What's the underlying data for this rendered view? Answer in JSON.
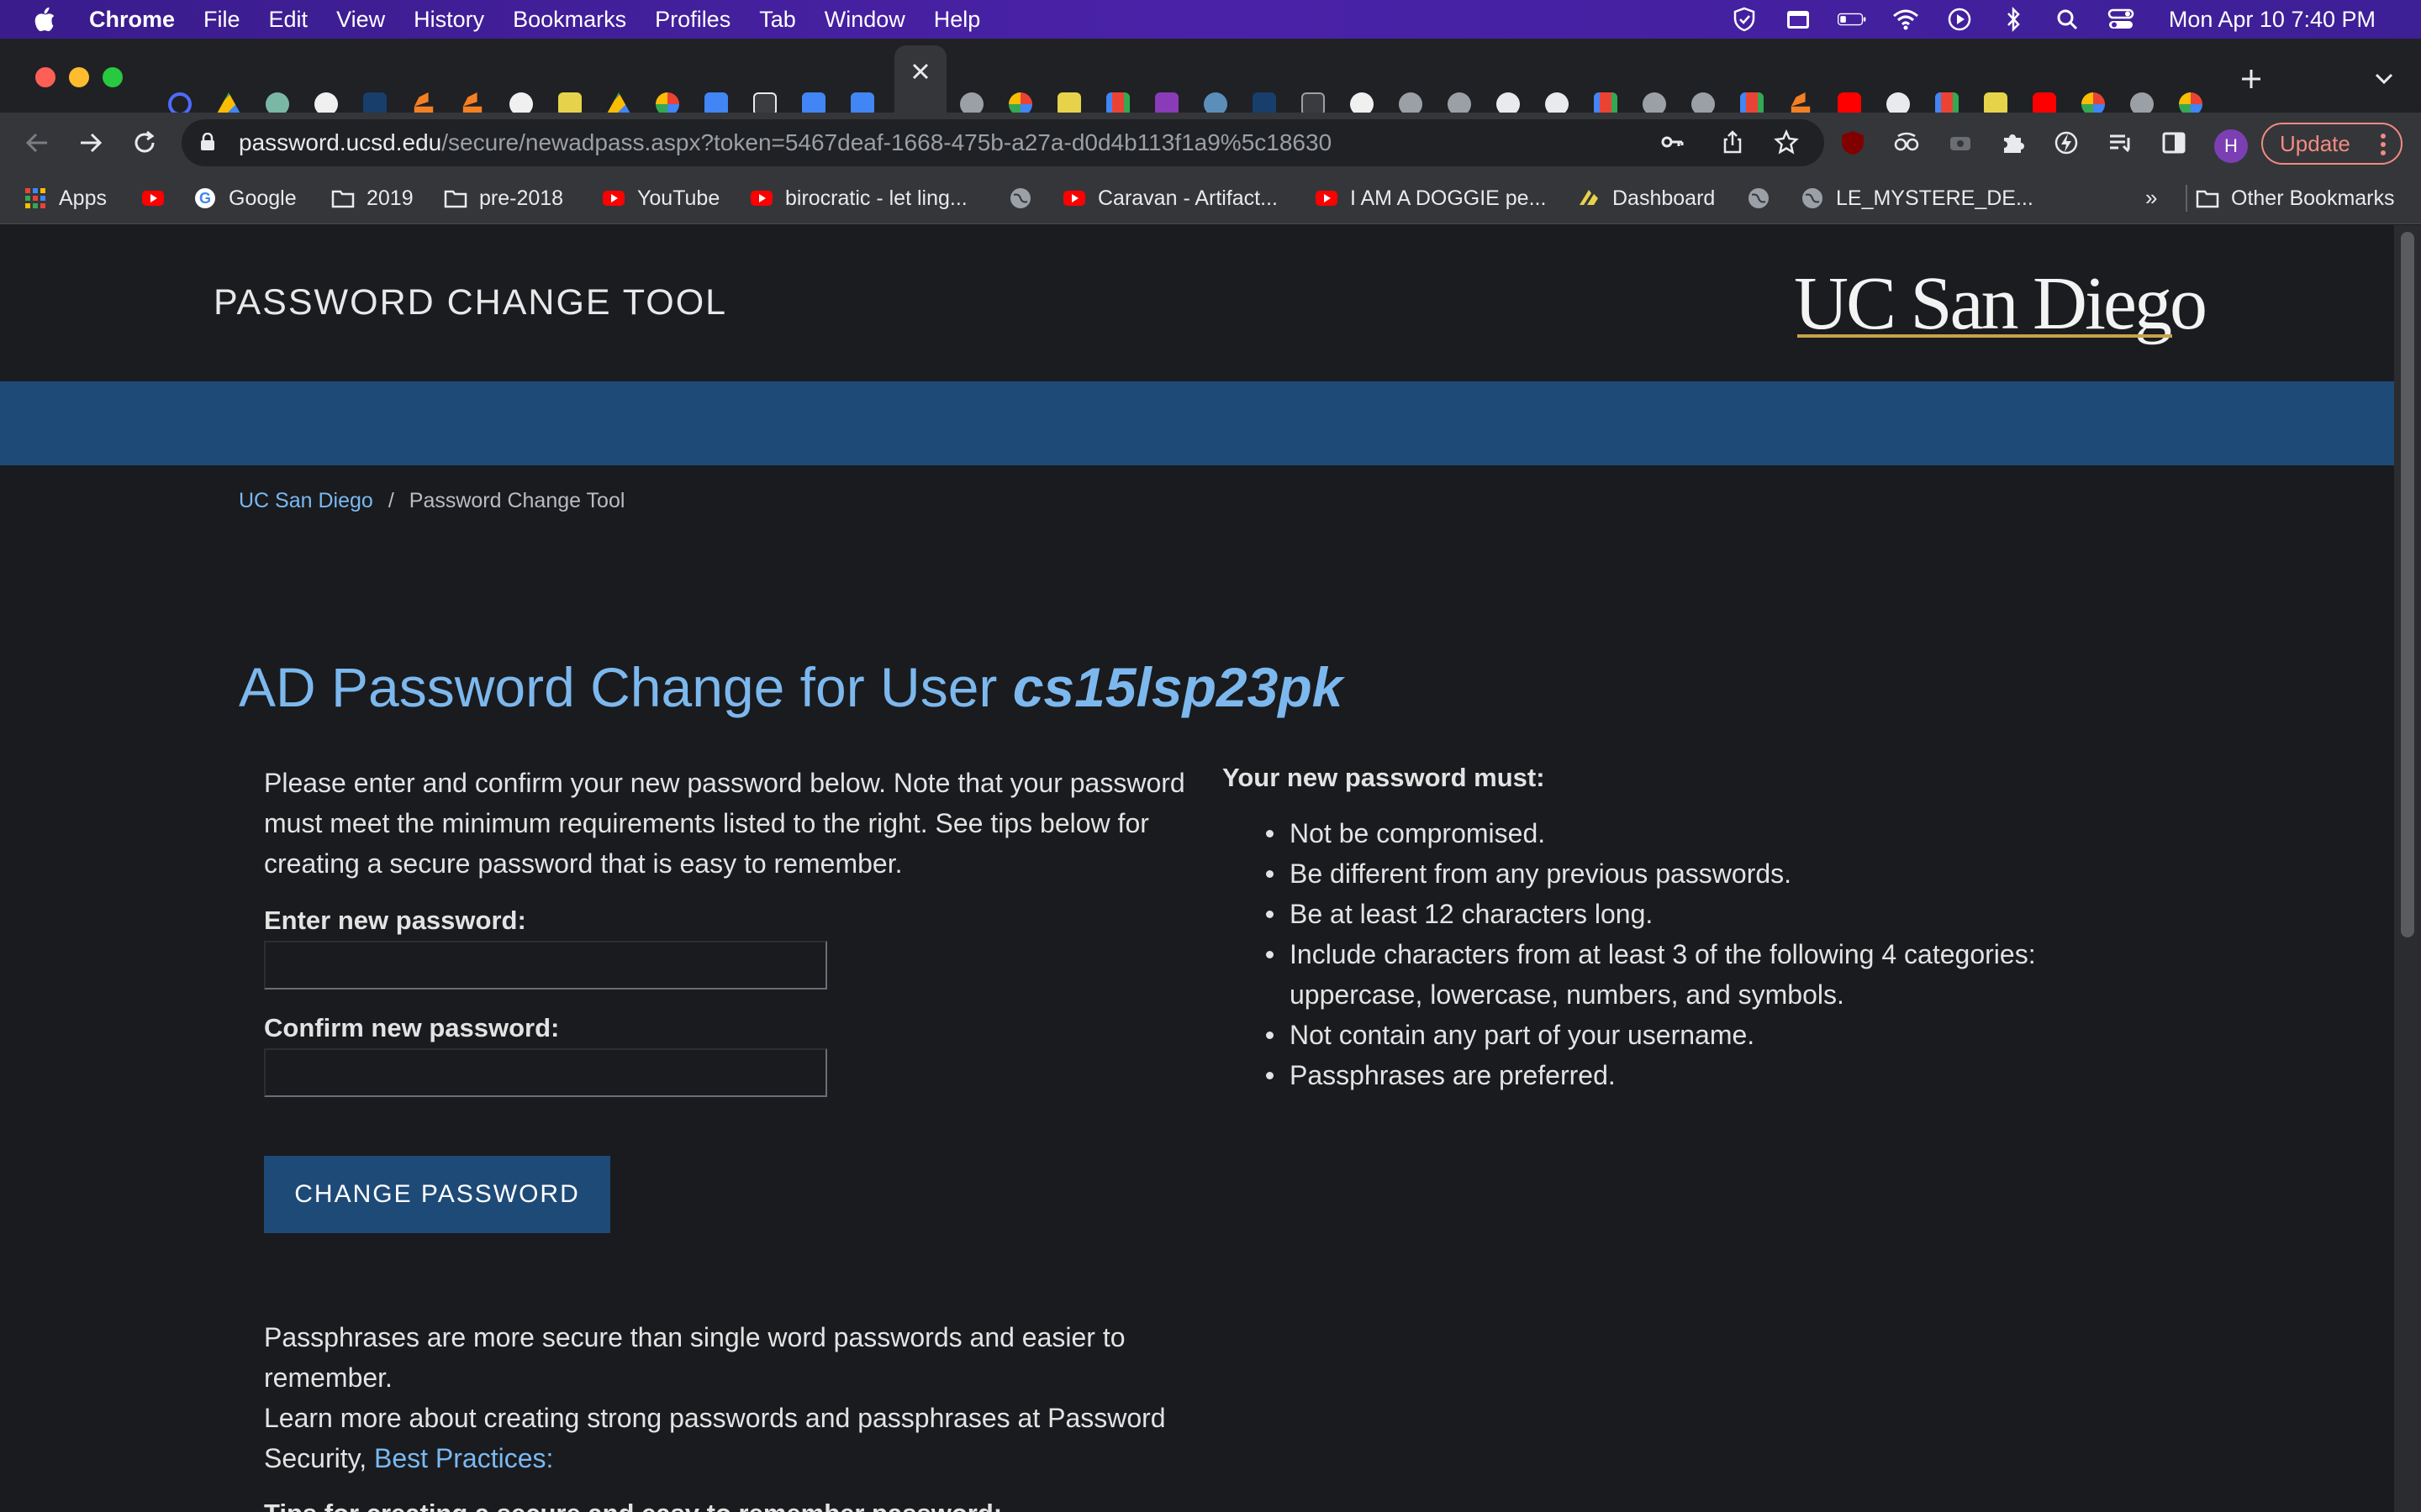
{
  "menubar": {
    "app": "Chrome",
    "items": [
      "File",
      "Edit",
      "View",
      "History",
      "Bookmarks",
      "Profiles",
      "Tab",
      "Window",
      "Help"
    ],
    "clock": "Mon Apr 10  7:40 PM"
  },
  "toolbar": {
    "url_host": "password.ucsd.edu",
    "url_path": "/secure/newadpass.aspx?token=5467deaf-1668-475b-a27a-d0d4b113f1a9%5c18630",
    "avatar_initial": "H",
    "update_label": "Update"
  },
  "bookmarks": {
    "items": [
      {
        "label": "Apps",
        "icon": "apps-grid-icon"
      },
      {
        "label": "",
        "icon": "youtube-icon"
      },
      {
        "label": "Google",
        "icon": "google-icon"
      },
      {
        "label": "2019",
        "icon": "folder-icon"
      },
      {
        "label": "pre-2018",
        "icon": "folder-icon"
      },
      {
        "label": "YouTube",
        "icon": "youtube-icon"
      },
      {
        "label": "birocratic - let ling...",
        "icon": "youtube-icon"
      },
      {
        "label": "",
        "icon": "globe-icon"
      },
      {
        "label": "Caravan - Artifact...",
        "icon": "youtube-icon"
      },
      {
        "label": "I AM A DOGGIE pe...",
        "icon": "youtube-icon"
      },
      {
        "label": "Dashboard",
        "icon": "dashboard-icon"
      },
      {
        "label": "",
        "icon": "globe-icon"
      },
      {
        "label": "LE_MYSTERE_DE...",
        "icon": "globe-icon"
      }
    ],
    "more": "»",
    "other": "Other Bookmarks"
  },
  "page": {
    "site_title": "PASSWORD CHANGE TOOL",
    "logo_text": "UC San Diego",
    "breadcrumb": {
      "home": "UC San Diego",
      "separator": "/",
      "current": "Password Change Tool"
    },
    "heading_prefix": "AD Password Change for User ",
    "username": "cs15lsp23pk",
    "intro": "Please enter and confirm your new password below. Note that your password must meet the minimum requirements listed to the right. See tips below for creating a secure password that is easy to remember.",
    "new_password_label": "Enter new password:",
    "confirm_password_label": "Confirm new password:",
    "new_password_value": "",
    "confirm_password_value": "",
    "change_button": "CHANGE PASSWORD",
    "passphrase_note": "Passphrases are more secure than single word passwords and easier to remember.",
    "learn_more": "Learn more about creating strong passwords and passphrases at Password Security, ",
    "best_practices_link": "Best Practices:",
    "tips_heading": "Tips for creating a secure and easy to remember password:",
    "requirements_title": "Your new password must:",
    "requirements": [
      "Not be compromised.",
      "Be different from any previous passwords.",
      "Be at least 12 characters long.",
      "Include characters from at least 3 of the following 4 categories: uppercase, lowercase, numbers, and symbols.",
      "Not contain any part of your username.",
      "Passphrases are preferred."
    ]
  },
  "colors": {
    "menubar": "#4a22a8",
    "header_band": "#1e4a77",
    "link": "#79b9f2",
    "heading": "#7cb8ee",
    "page_bg": "#1a1b1e"
  }
}
